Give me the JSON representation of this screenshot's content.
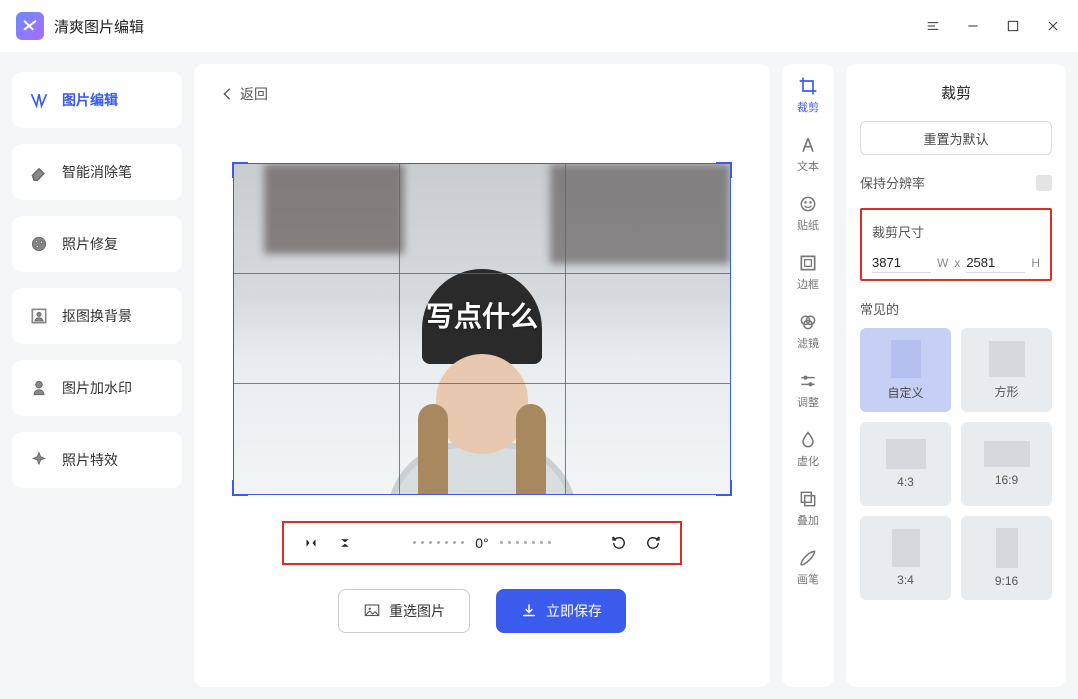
{
  "app": {
    "title": "清爽图片编辑"
  },
  "nav": {
    "items": [
      {
        "label": "图片编辑"
      },
      {
        "label": "智能消除笔"
      },
      {
        "label": "照片修复"
      },
      {
        "label": "抠图换背景"
      },
      {
        "label": "图片加水印"
      },
      {
        "label": "照片特效"
      }
    ]
  },
  "canvas": {
    "back_label": "返回",
    "overlay_text": "写点什么",
    "angle": "0°",
    "reselect_label": "重选图片",
    "save_label": "立即保存"
  },
  "rail": {
    "items": [
      {
        "label": "裁剪"
      },
      {
        "label": "文本"
      },
      {
        "label": "贴纸"
      },
      {
        "label": "边框"
      },
      {
        "label": "滤镜"
      },
      {
        "label": "调整"
      },
      {
        "label": "虚化"
      },
      {
        "label": "叠加"
      },
      {
        "label": "画笔"
      }
    ]
  },
  "panel": {
    "title": "裁剪",
    "reset_label": "重置为默认",
    "keep_res_label": "保持分辨率",
    "size_label": "裁剪尺寸",
    "width_value": "3871",
    "height_value": "2581",
    "w_suffix": "W",
    "h_suffix": "H",
    "x_char": "x",
    "common_label": "常见的",
    "aspects": [
      {
        "label": "自定义"
      },
      {
        "label": "方形"
      },
      {
        "label": "4:3"
      },
      {
        "label": "16:9"
      },
      {
        "label": "3:4"
      },
      {
        "label": "9:16"
      }
    ]
  }
}
